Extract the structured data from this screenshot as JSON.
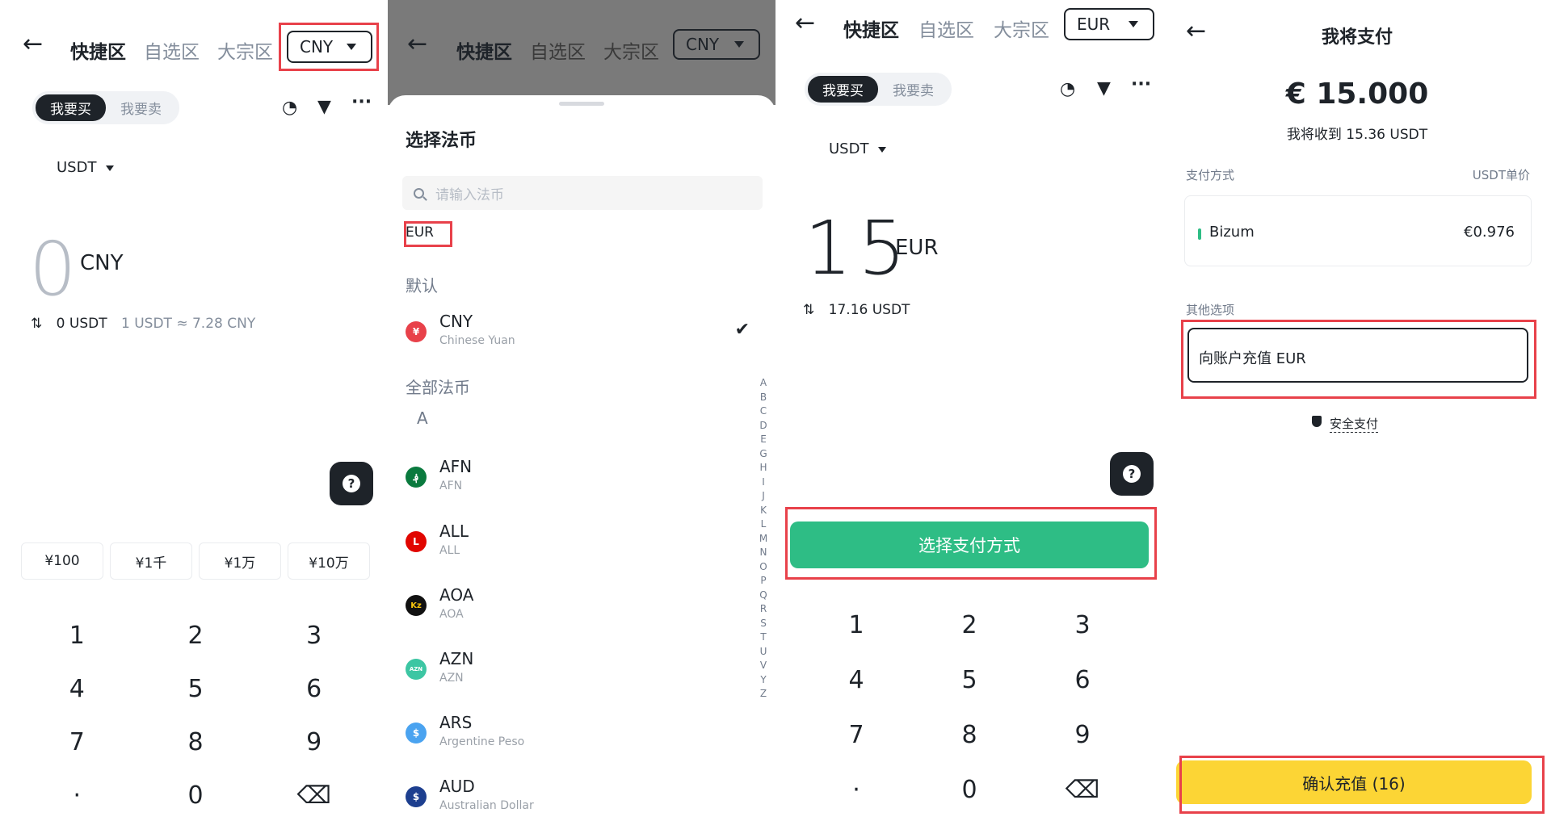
{
  "panel1": {
    "tabs": [
      "快捷区",
      "自选区",
      "大宗区"
    ],
    "currency": "CNY",
    "toggle": [
      "我要买",
      "我要卖"
    ],
    "asset": "USDT",
    "amount": "0",
    "unit": "CNY",
    "conv_value": "0 USDT",
    "conv_rate": "1 USDT ≈ 7.28 CNY",
    "quick": [
      "¥100",
      "¥1千",
      "¥1万",
      "¥10万"
    ],
    "keys": [
      "1",
      "2",
      "3",
      "4",
      "5",
      "6",
      "7",
      "8",
      "9",
      "·",
      "0",
      "⌫"
    ]
  },
  "panel2": {
    "tabs": [
      "快捷区",
      "自选区",
      "大宗区"
    ],
    "currency": "CNY",
    "title": "选择法币",
    "search_placeholder": "请输入法币",
    "chip": "EUR",
    "section_default": "默认",
    "default_item": {
      "code": "CNY",
      "name": "Chinese Yuan",
      "glyph": "¥",
      "color": "#e8414a"
    },
    "section_all": "全部法币",
    "letter": "A",
    "items": [
      {
        "code": "AFN",
        "name": "AFN",
        "glyph": "؋",
        "color": "#0a7a3e"
      },
      {
        "code": "ALL",
        "name": "ALL",
        "glyph": "L",
        "color": "#e10600"
      },
      {
        "code": "AOA",
        "name": "AOA",
        "glyph": "Kz",
        "color": "#111111"
      },
      {
        "code": "AZN",
        "name": "AZN",
        "glyph": "AZN",
        "color": "#3cc6a3"
      },
      {
        "code": "ARS",
        "name": "Argentine Peso",
        "glyph": "$",
        "color": "#4aa3f0"
      },
      {
        "code": "AUD",
        "name": "Australian Dollar",
        "glyph": "$",
        "color": "#1d3f8f"
      }
    ],
    "alphabet": [
      "A",
      "B",
      "C",
      "D",
      "E",
      "G",
      "H",
      "I",
      "J",
      "K",
      "L",
      "M",
      "N",
      "O",
      "P",
      "Q",
      "R",
      "S",
      "T",
      "U",
      "V",
      "Y",
      "Z"
    ]
  },
  "panel3": {
    "tabs": [
      "快捷区",
      "自选区",
      "大宗区"
    ],
    "currency": "EUR",
    "toggle": [
      "我要买",
      "我要卖"
    ],
    "asset": "USDT",
    "amount": "15",
    "unit": "EUR",
    "conv_value": "17.16 USDT",
    "cta": "选择支付方式",
    "keys": [
      "1",
      "2",
      "3",
      "4",
      "5",
      "6",
      "7",
      "8",
      "9",
      "·",
      "0",
      "⌫"
    ]
  },
  "panel4": {
    "title": "我将支付",
    "amount": "€ 15.000",
    "receive": "我将收到 15.36 USDT",
    "pay_label": "支付方式",
    "price_label": "USDT单价",
    "method": "Bizum",
    "price": "€0.976",
    "other_label": "其他选项",
    "topup": "向账户充值 EUR",
    "secure": "安全支付",
    "confirm": "确认充值 (16)"
  }
}
